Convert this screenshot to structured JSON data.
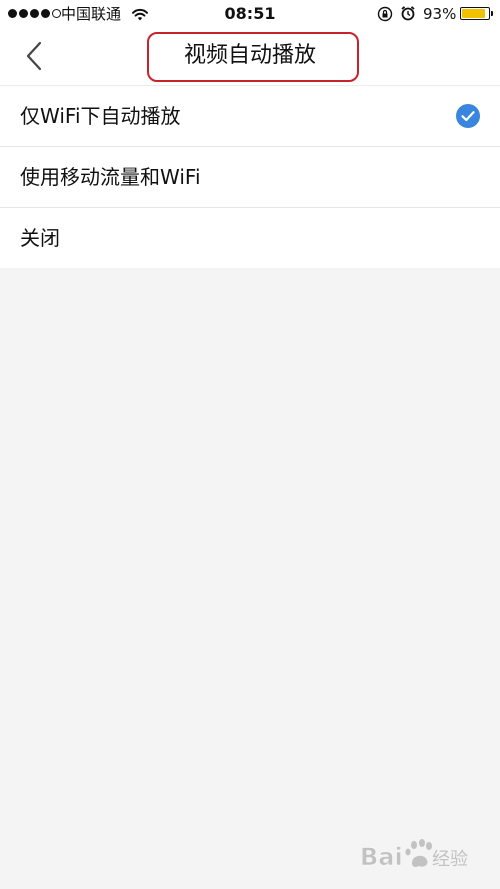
{
  "status_bar": {
    "carrier": "中国联通",
    "time": "08:51",
    "battery_percent": "93%",
    "battery_level": 0.93,
    "signal_bars_filled": 4,
    "signal_bars_total": 5,
    "icons": [
      "signal-dots-icon",
      "wifi-icon",
      "orientation-lock-icon",
      "alarm-icon",
      "battery-icon"
    ]
  },
  "nav": {
    "title": "视频自动播放",
    "back_icon": "chevron-left-icon",
    "highlight_color": "#c8232c"
  },
  "options": [
    {
      "label": "仅WiFi下自动播放",
      "selected": true
    },
    {
      "label": "使用移动流量和WiFi",
      "selected": false
    },
    {
      "label": "关闭",
      "selected": false
    }
  ],
  "colors": {
    "accent": "#3a86de",
    "background": "#f4f4f4",
    "battery": "#f2c200"
  },
  "watermark": {
    "brand": "Bai",
    "suffix": "经验",
    "icon": "paw-icon"
  }
}
